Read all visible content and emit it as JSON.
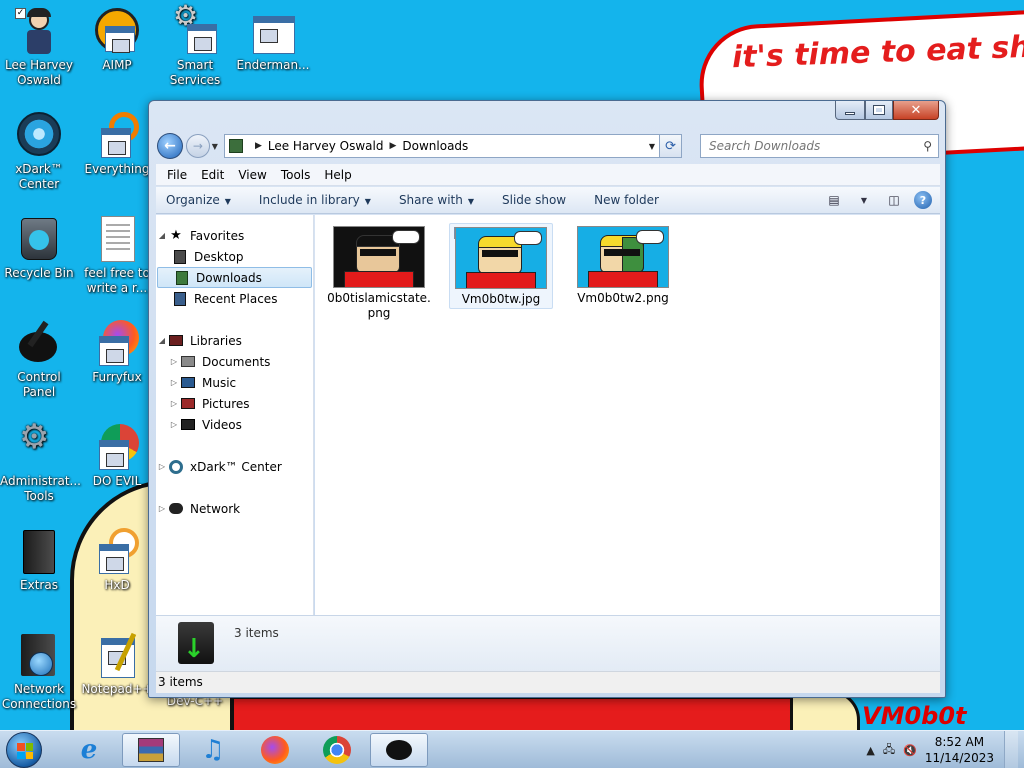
{
  "wallpaper": {
    "speech_text": "it's time to eat shit and die and chew",
    "signature": "VM0b0t"
  },
  "desktop_icons": [
    {
      "label": "Lee Harvey Oswald",
      "icon": "user-figure-icon"
    },
    {
      "label": "AIMP",
      "icon": "aimp-icon"
    },
    {
      "label": "Smart Services",
      "icon": "gear-icon"
    },
    {
      "label": "Enderman...",
      "icon": "app-icon"
    },
    {
      "label": "xDark™ Center",
      "icon": "xdark-icon"
    },
    {
      "label": "Everything",
      "icon": "search-icon"
    },
    {
      "label": "Recycle Bin",
      "icon": "recycle-bin-icon"
    },
    {
      "label": "feel free to write a r...",
      "icon": "text-document-icon"
    },
    {
      "label": "Control Panel",
      "icon": "control-panel-icon"
    },
    {
      "label": "Furryfux",
      "icon": "firefox-icon"
    },
    {
      "label": "Administrat... Tools",
      "icon": "admin-tools-icon"
    },
    {
      "label": "DO EVIL",
      "icon": "chrome-icon"
    },
    {
      "label": "Extras",
      "icon": "folder-icon"
    },
    {
      "label": "HxD",
      "icon": "hxd-icon"
    },
    {
      "label": "Network Connections",
      "icon": "network-icon"
    },
    {
      "label": "Notepad++",
      "icon": "notepad-icon"
    },
    {
      "label": "Dev-C++",
      "icon": "devcpp-icon"
    }
  ],
  "explorer": {
    "address": {
      "root": "Lee Harvey Oswald",
      "current": "Downloads"
    },
    "search_placeholder": "Search Downloads",
    "menu": [
      "File",
      "Edit",
      "View",
      "Tools",
      "Help"
    ],
    "commands": [
      {
        "label": "Organize",
        "has_dropdown": true
      },
      {
        "label": "Include in library",
        "has_dropdown": true
      },
      {
        "label": "Share with",
        "has_dropdown": true
      },
      {
        "label": "Slide show",
        "has_dropdown": false
      },
      {
        "label": "New folder",
        "has_dropdown": false
      }
    ],
    "nav": {
      "favorites": {
        "label": "Favorites",
        "items": [
          "Desktop",
          "Downloads",
          "Recent Places"
        ]
      },
      "libraries": {
        "label": "Libraries",
        "items": [
          "Documents",
          "Music",
          "Pictures",
          "Videos"
        ]
      },
      "xdark": "xDark™ Center",
      "network": "Network",
      "selected": "Downloads"
    },
    "files": [
      {
        "name": "0b0tislamicstate.png"
      },
      {
        "name": "Vm0b0tw.jpg"
      },
      {
        "name": "Vm0b0tw2.png"
      }
    ],
    "details_count": "3 items",
    "status_count": "3 items"
  },
  "taskbar": {
    "pinned": [
      {
        "name": "internet-explorer",
        "icon": "ie-icon"
      },
      {
        "name": "winrar",
        "icon": "archive-icon"
      },
      {
        "name": "music-player",
        "icon": "music-note-icon"
      },
      {
        "name": "firefox",
        "icon": "firefox-icon"
      },
      {
        "name": "chrome",
        "icon": "chrome-icon"
      },
      {
        "name": "control-panel",
        "icon": "control-panel-icon"
      }
    ],
    "time": "8:52 AM",
    "date": "11/14/2023"
  },
  "colors": {
    "wallpaper_blue": "#14b4ec",
    "speech_red": "#e41d1d",
    "shirt_red": "#e51c1c"
  }
}
